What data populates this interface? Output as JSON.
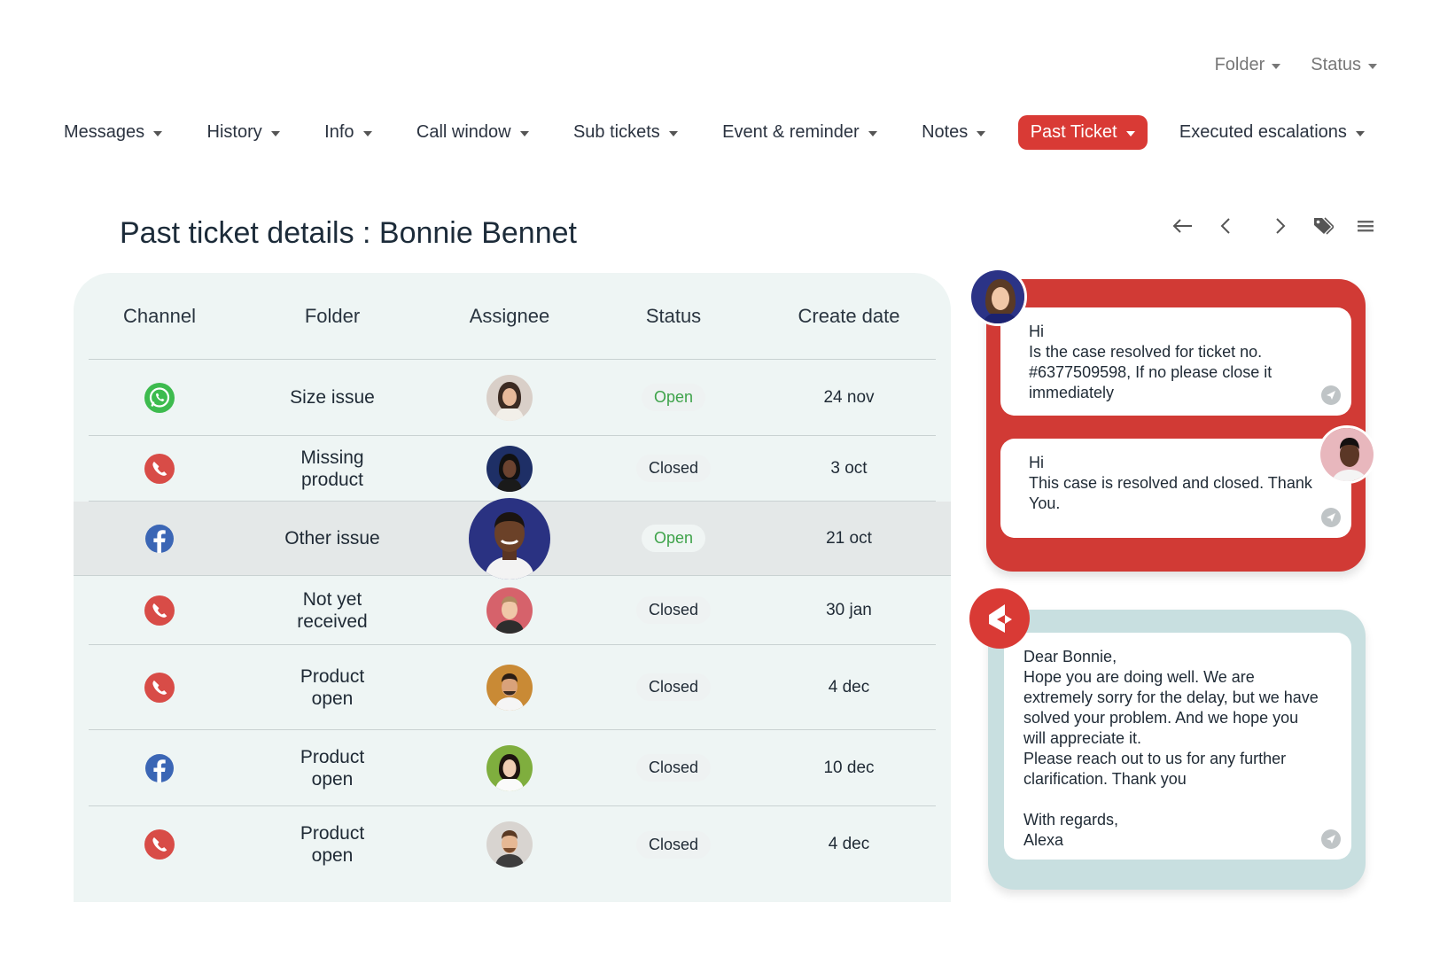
{
  "filters": [
    {
      "label": "Folder"
    },
    {
      "label": "Status"
    }
  ],
  "tabs": [
    {
      "label": "Messages",
      "active": false
    },
    {
      "label": "History",
      "active": false
    },
    {
      "label": "Info",
      "active": false
    },
    {
      "label": "Call window",
      "active": false
    },
    {
      "label": "Sub tickets",
      "active": false
    },
    {
      "label": "Event & reminder",
      "active": false
    },
    {
      "label": "Notes",
      "active": false
    },
    {
      "label": "Past Ticket",
      "active": true
    },
    {
      "label": "Executed escalations",
      "active": false
    }
  ],
  "page": {
    "title": "Past ticket details : Bonnie Bennet"
  },
  "nav_icons": [
    "arrow-left-icon",
    "chevron-left-icon",
    "chevron-right-icon",
    "tags-icon",
    "menu-icon"
  ],
  "table": {
    "columns": [
      "Channel",
      "Folder",
      "Assignee",
      "Status",
      "Create date"
    ],
    "rows": [
      {
        "channel": "whatsapp",
        "folder": "Size issue",
        "status": "Open",
        "date": "24 nov"
      },
      {
        "channel": "phone",
        "folder": "Missing product",
        "status": "Closed",
        "date": "3 oct"
      },
      {
        "channel": "facebook",
        "folder": "Other issue",
        "status": "Open",
        "date": "21 oct"
      },
      {
        "channel": "phone",
        "folder": "Not yet received",
        "status": "Closed",
        "date": "30 jan"
      },
      {
        "channel": "phone",
        "folder": "Product open",
        "status": "Closed",
        "date": "4 dec"
      },
      {
        "channel": "facebook",
        "folder": "Product open",
        "status": "Closed",
        "date": "10 dec"
      },
      {
        "channel": "phone",
        "folder": "Product open",
        "status": "Closed",
        "date": "4 dec"
      }
    ]
  },
  "chat": {
    "customer_message": "Hi\nIs the case resolved for ticket no. #6377509598, If no please close it immediately",
    "agent_message": "Hi\nThis case is resolved and closed. Thank You.",
    "reply_message": "Dear Bonnie,\nHope you are doing well. We are extremely sorry for the delay, but we have solved your problem. And we hope you will appreciate it.\nPlease reach out to us for any further clarification. Thank you\n\nWith regards,\nAlexa"
  },
  "colors": {
    "accent": "#d93a35",
    "open_status": "#3ea34a",
    "table_bg": "#eef5f4",
    "reply_panel": "#c8dfe0",
    "whatsapp": "#3dbb4e",
    "phone": "#d84c47",
    "facebook": "#3b66b5"
  }
}
